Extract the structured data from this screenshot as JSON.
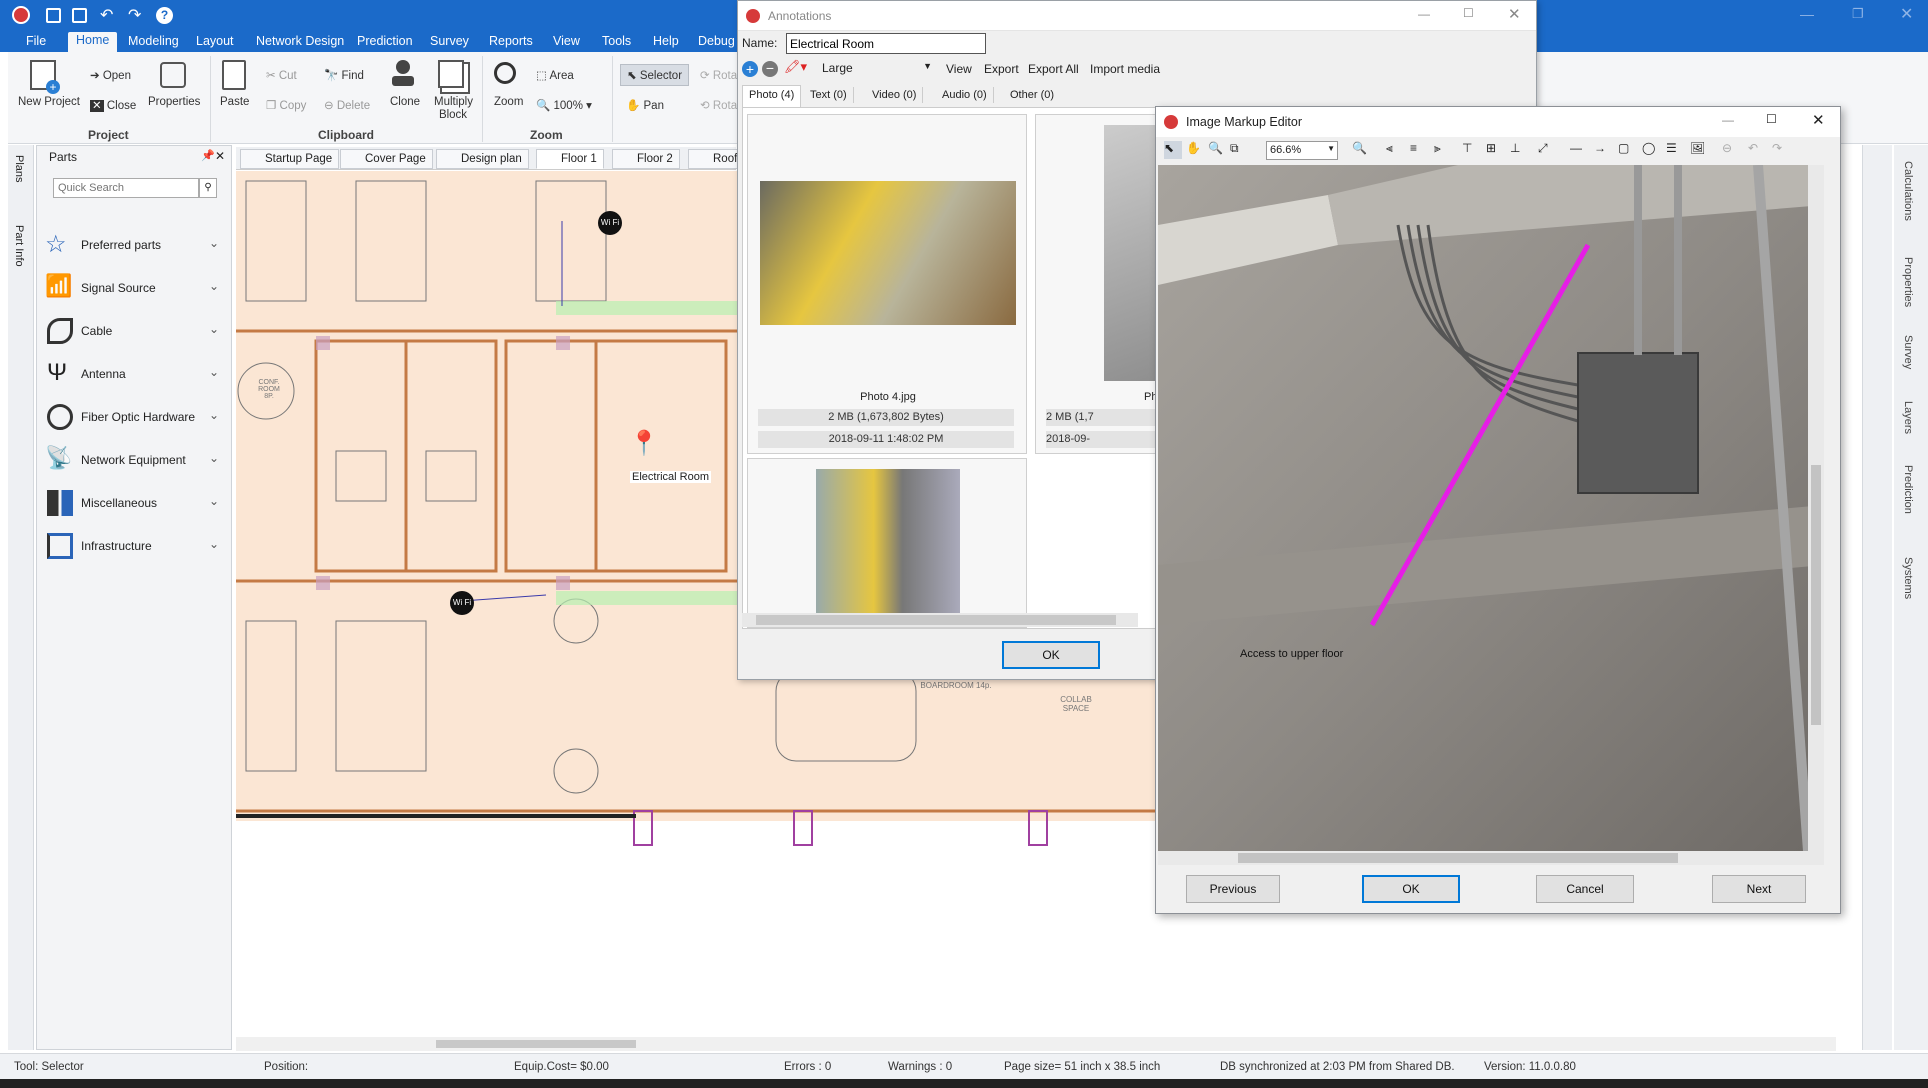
{
  "menu": {
    "file": "File",
    "items": [
      "Home",
      "Modeling",
      "Layout",
      "Network Design",
      "Prediction",
      "Survey",
      "Reports",
      "View",
      "Tools",
      "Help",
      "Debug"
    ],
    "active": "Home"
  },
  "ribbon": {
    "new_project": "New Project",
    "open": "Open",
    "close": "Close",
    "properties": "Properties",
    "paste": "Paste",
    "cut": "Cut",
    "copy": "Copy",
    "find": "Find",
    "delete": "Delete",
    "clone": "Clone",
    "multiply_block": "Multiply Block",
    "zoom": "Zoom",
    "area": "Area",
    "zoom_level": "100%",
    "selector": "Selector",
    "pan": "Pan",
    "rotate": "Rota",
    "groups": {
      "project": "Project",
      "clipboard": "Clipboard",
      "zoom": "Zoom"
    }
  },
  "left_strip": {
    "plans": "Plans",
    "part_info": "Part Info"
  },
  "parts_panel": {
    "title": "Parts",
    "search_placeholder": "Quick Search",
    "items": [
      "Preferred parts",
      "Signal Source",
      "Cable",
      "Antenna",
      "Fiber Optic Hardware",
      "Network Equipment",
      "Miscellaneous",
      "Infrastructure"
    ]
  },
  "doc_tabs": [
    "Startup Page",
    "Cover Page",
    "Design plan",
    "Floor 1",
    "Floor 2",
    "Roof"
  ],
  "active_doc_tab": "Floor 1",
  "floorplan": {
    "label_electrical": "Electrical Room",
    "wifi": "Wi Fi",
    "conf_room": "CONF. ROOM 8P.",
    "boardroom": "BOARDROOM 14p.",
    "collab": "COLLAB SPACE"
  },
  "annotations": {
    "window_title": "Annotations",
    "name_label": "Name:",
    "name_value": "Electrical Room",
    "size_select": "Large",
    "toolbar": [
      "View",
      "Export",
      "Export All",
      "Import media"
    ],
    "tabs": [
      "Photo (4)",
      "Text (0)",
      "Video (0)",
      "Audio (0)",
      "Other (0)"
    ],
    "photos": [
      {
        "name": "Photo 4.jpg",
        "size": "2 MB (1,673,802 Bytes)",
        "date": "2018-09-11 1:48:02 PM"
      },
      {
        "name": "Pho",
        "size": "2 MB (1,7",
        "date": "2018-09-"
      }
    ],
    "ok": "OK"
  },
  "markup_editor": {
    "window_title": "Image Markup Editor",
    "zoom_value": "66.6%",
    "caption": "Access to upper floor",
    "buttons": {
      "previous": "Previous",
      "ok": "OK",
      "cancel": "Cancel",
      "next": "Next"
    },
    "line_color": "#e61ee6"
  },
  "right_tabs": [
    "Calculations",
    "Properties",
    "Survey",
    "Layers",
    "Prediction",
    "Systems"
  ],
  "status": {
    "tool": "Tool: Selector",
    "position": "Position:",
    "cost": "Equip.Cost= $0.00",
    "errors": "Errors : 0",
    "warnings": "Warnings : 0",
    "page_size": "Page size= 51 inch x 38.5 inch",
    "db": "DB synchronized at 2:03 PM from Shared DB.",
    "version": "Version: 11.0.0.80"
  },
  "colors": {
    "brand": "#1b6ac9",
    "floor": "#fbe6d4",
    "wall": "#c47a45",
    "door": "#a040a0"
  }
}
